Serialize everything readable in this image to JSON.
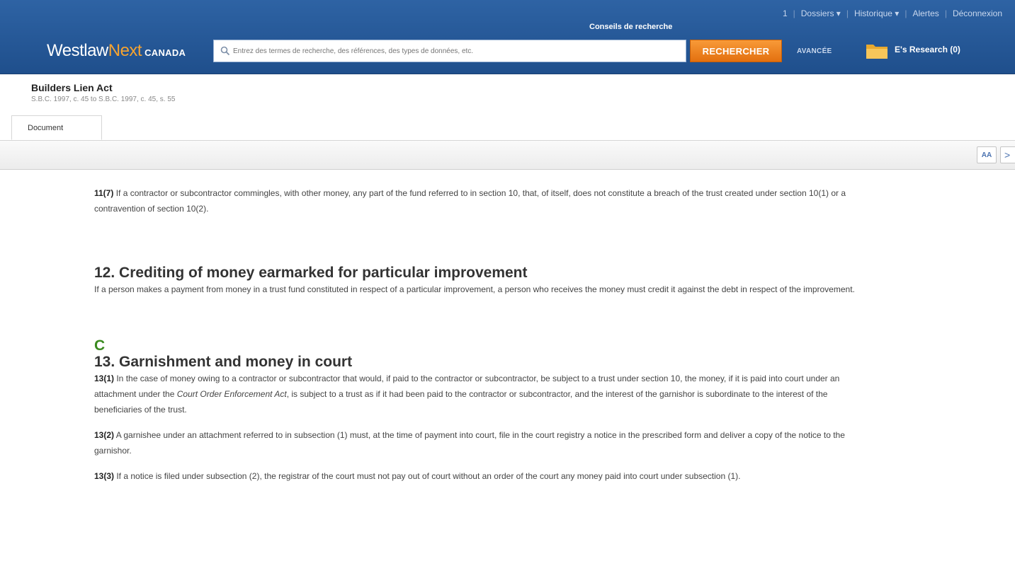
{
  "header": {
    "top_links": [
      "1",
      "Dossiers ▾",
      "Historique ▾",
      "Alertes",
      "Déconnexion"
    ],
    "search_tips": "Conseils de recherche",
    "logo_main": "Westlaw",
    "logo_next": "Next",
    "logo_suffix": "CANADA",
    "search_placeholder": "Entrez des termes de recherche, des références, des types de données, etc.",
    "search_button": "RECHERCHER",
    "advanced": "AVANCÉE",
    "research_folder": "E's Research (0)"
  },
  "document": {
    "title": "Builders Lien Act",
    "citation": "S.B.C. 1997, c. 45 to S.B.C. 1997, c. 45, s. 55",
    "tab": "Document",
    "text_size_button": "AA",
    "next_button": ">"
  },
  "body": {
    "p11_7_num": "11(7)",
    "p11_7_text": " If a contractor or subcontractor commingles, with other money, any part of the fund referred to in section 10, that, of itself, does not constitute a breach of the trust created under section 10(1) or a contravention of section 10(2).",
    "s12_heading": "12. Crediting of money earmarked for particular improvement",
    "s12_text": "If a person makes a payment from money in a trust fund constituted in respect of a particular improvement, a person who receives the money must credit it against the debt in respect of the improvement.",
    "flag": "C",
    "s13_heading": "13. Garnishment and money in court",
    "p13_1_num": "13(1)",
    "p13_1_text_a": " In the case of money owing to a contractor or subcontractor that would, if paid to the contractor or subcontractor, be subject to a trust under section 10, the money, if it is paid into court under an attachment under the ",
    "p13_1_italic": "Court Order Enforcement Act",
    "p13_1_text_b": ", is subject to a trust as if it had been paid to the contractor or subcontractor, and the interest of the garnishor is subordinate to the interest of the beneficiaries of the trust.",
    "p13_2_num": "13(2)",
    "p13_2_text": " A garnishee under an attachment referred to in subsection (1) must, at the time of payment into court, file in the court registry a notice in the prescribed form and deliver a copy of the notice to the garnishor.",
    "p13_3_num": "13(3)",
    "p13_3_text": " If a notice is filed under subsection (2), the registrar of the court must not pay out of court without an order of the court any money paid into court under subsection (1)."
  },
  "colors": {
    "header_blue": "#2e63a4",
    "accent_orange": "#f6a330",
    "search_button": "#e3700f",
    "flag_green": "#3a8a1f"
  }
}
